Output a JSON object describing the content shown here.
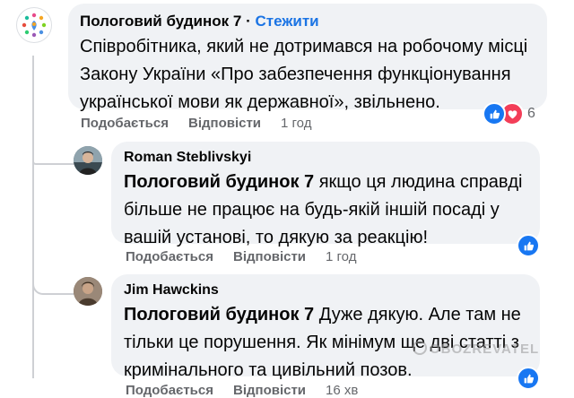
{
  "comments": [
    {
      "author": "Пологовий будинок 7",
      "follow_label": "Стежити",
      "separator": "·",
      "text_lines": [
        "Співробітника, який не дотримався на робочому місці",
        "Закону України «Про забезпечення функціонування",
        "української мови як державної», звільнено."
      ],
      "actions": {
        "like": "Подобається",
        "reply": "Відповісти",
        "time": "1 год"
      },
      "reactions": [
        "like",
        "love"
      ],
      "reaction_count": "6"
    },
    {
      "author": "Roman Steblivskyi",
      "tag": "Пологовий будинок 7",
      "text_lines": [
        " якщо ця людина справді",
        "більше не працює на будь-якій іншій посаді у",
        "вашій установі, то дякую за реакцію!"
      ],
      "actions": {
        "like": "Подобається",
        "reply": "Відповісти",
        "time": "1 год"
      },
      "reactions": [
        "like"
      ]
    },
    {
      "author": "Jim Hawckins",
      "tag": "Пологовий будинок 7",
      "text_lines": [
        " Дуже дякую. Але там не",
        "тільки це порушення. Як мінімум ще дві статті з",
        "кримінального та цивільний позов."
      ],
      "actions": {
        "like": "Подобається",
        "reply": "Відповісти",
        "time": "16 хв"
      },
      "reactions": [
        "like"
      ]
    }
  ],
  "watermark": "OBOZREVATEL",
  "colors": {
    "bubble": "#f0f2f5",
    "link": "#1b74e4",
    "like": "#1877f2",
    "love": "#f33e58",
    "meta": "#65676b"
  }
}
